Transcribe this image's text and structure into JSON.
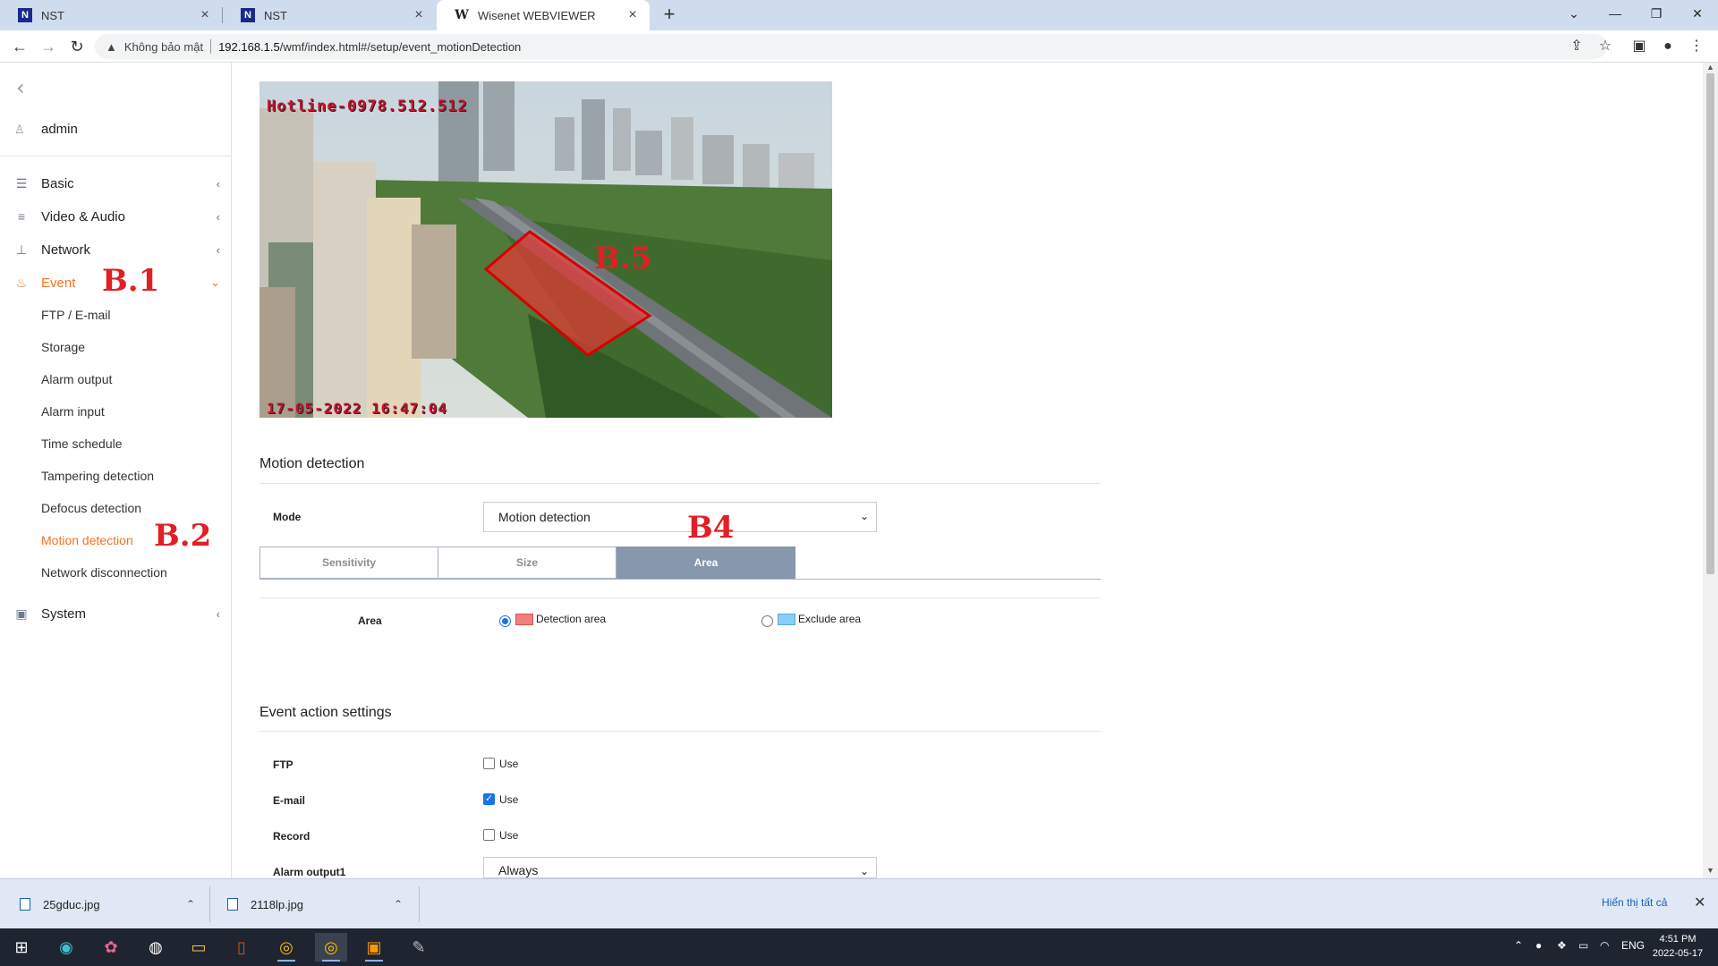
{
  "browser": {
    "tabs": [
      {
        "title": "NST",
        "favicon": "N",
        "active": false
      },
      {
        "title": "NST",
        "favicon": "N",
        "active": false
      },
      {
        "title": "Wisenet WEBVIEWER",
        "favicon": "W",
        "active": true
      }
    ],
    "not_secure": "Không bảo mật",
    "url_host": "192.168.1.5",
    "url_path": "/wmf/index.html#/setup/event_motionDetection"
  },
  "sidebar": {
    "user": "admin",
    "menus": [
      {
        "label": "Basic",
        "icon": "list-icon"
      },
      {
        "label": "Video & Audio",
        "icon": "sliders-icon"
      },
      {
        "label": "Network",
        "icon": "network-icon"
      },
      {
        "label": "Event",
        "icon": "alarm-icon"
      },
      {
        "label": "System",
        "icon": "system-icon"
      }
    ],
    "event_items": [
      "FTP / E-mail",
      "Storage",
      "Alarm output",
      "Alarm input",
      "Time schedule",
      "Tampering detection",
      "Defocus detection",
      "Motion detection",
      "Network disconnection"
    ],
    "active_item": "Motion detection"
  },
  "annotations": {
    "b1": "B.1",
    "b2": "B.2",
    "b4": "B4",
    "b5": "B.5"
  },
  "camera": {
    "osd_top": "Hotline-0978.512.512",
    "osd_bottom": "17-05-2022 16:47:04"
  },
  "motion": {
    "section_title": "Motion detection",
    "mode_label": "Mode",
    "mode_value": "Motion detection",
    "tabs": [
      "Sensitivity",
      "Size",
      "Area"
    ],
    "active_tab": "Area",
    "area_label": "Area",
    "detection_area": "Detection area",
    "exclude_area": "Exclude area",
    "selected_area": "Detection area"
  },
  "event_actions": {
    "section_title": "Event action settings",
    "rows": [
      {
        "label": "FTP",
        "use": "Use",
        "checked": false
      },
      {
        "label": "E-mail",
        "use": "Use",
        "checked": true
      },
      {
        "label": "Record",
        "use": "Use",
        "checked": false
      }
    ],
    "alarm_label": "Alarm output1",
    "alarm_value": "Always"
  },
  "downloads": {
    "files": [
      "25gduc.jpg",
      "2118lp.jpg"
    ],
    "show_all": "Hiển thị tất cả"
  },
  "taskbar": {
    "language": "ENG",
    "time": "4:51 PM",
    "date": "2022-05-17"
  },
  "colors": {
    "accent": "#f37321",
    "active_tab_bg": "#8797ac",
    "detection_area": "#f08080",
    "exclude_area": "#87cefa",
    "annotation": "#e31e24"
  }
}
